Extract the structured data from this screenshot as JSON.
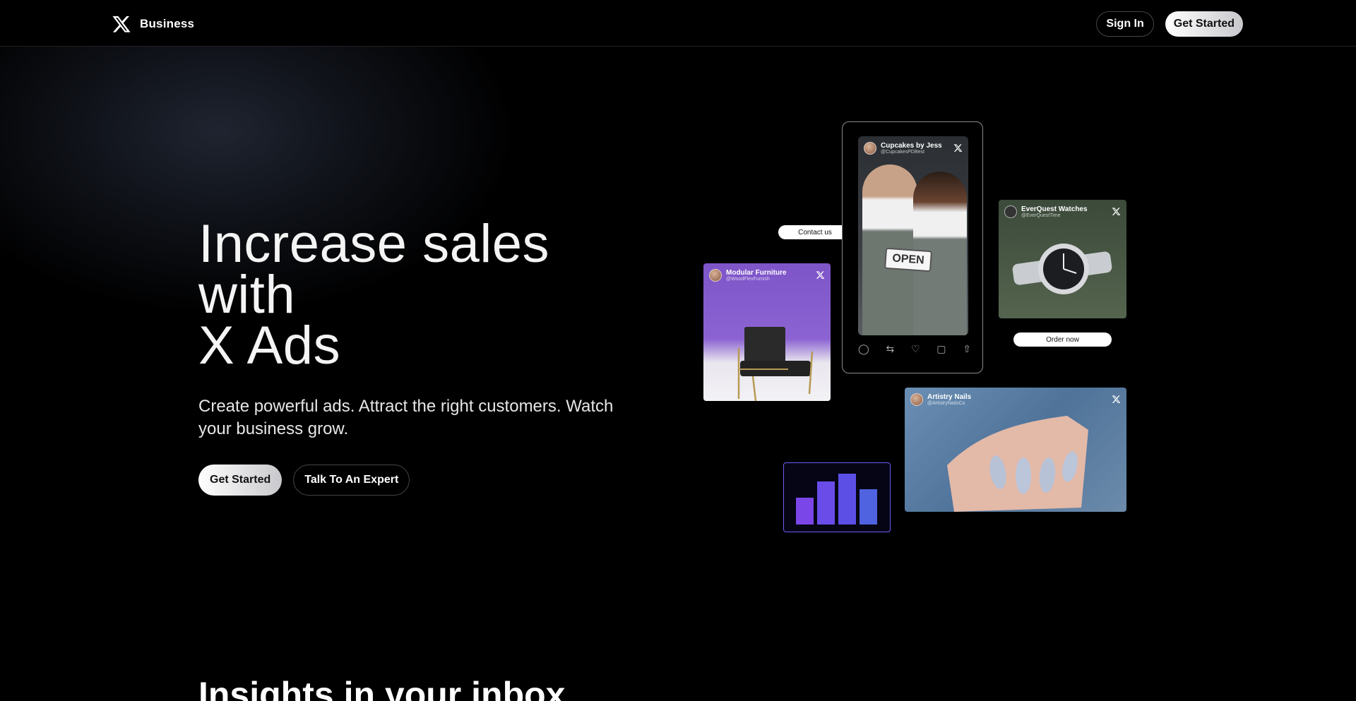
{
  "header": {
    "brand": "Business",
    "sign_in": "Sign In",
    "get_started": "Get Started"
  },
  "hero": {
    "title_line1": "Increase sales with",
    "title_line2": "X Ads",
    "subtitle": "Create powerful ads. Attract the right customers. Watch your business grow.",
    "primary_cta": "Get Started",
    "secondary_cta": "Talk To An Expert"
  },
  "collage": {
    "furniture": {
      "name": "Modular Furniture",
      "handle": "@WoodFlexFurnish"
    },
    "cupcakes": {
      "name": "Cupcakes by Jess",
      "handle": "@CupcakesPDBest",
      "sign": "OPEN"
    },
    "watches": {
      "name": "EverQuest Watches",
      "handle": "@EverQuestTime"
    },
    "nails": {
      "name": "Artistry Nails",
      "handle": "@ArtistryNailsCo"
    },
    "contact_pill": "Contact us",
    "order_pill": "Order now",
    "bar_colors": [
      "#7b46e8",
      "#6a4de8",
      "#5b4fe6",
      "#4f63e0"
    ]
  },
  "insights": {
    "heading": "Insights in your inbox"
  }
}
